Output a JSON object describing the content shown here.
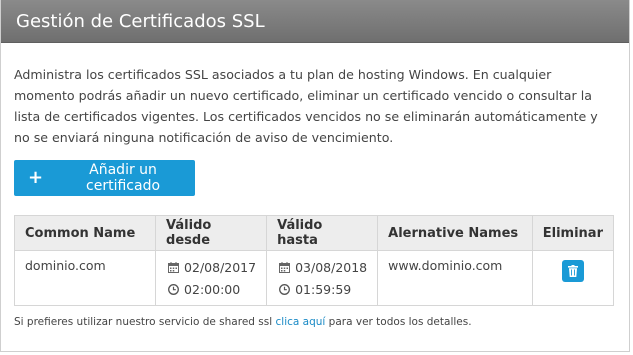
{
  "header": {
    "title": "Gestión de Certificados SSL"
  },
  "intro": "Administra los certificados SSL asociados a tu plan de hosting Windows. En cualquier momento podrás añadir un nuevo certificado, eliminar un certificado vencido o consultar la lista de certificados vigentes. Los certificados vencidos no se eliminarán automáticamente y no se enviará ninguna notificación de aviso de vencimiento.",
  "add_button": {
    "icon": "plus-icon",
    "label": "Añadir un certificado"
  },
  "table": {
    "headers": [
      "Common Name",
      "Válido desde",
      "Válido hasta",
      "Alernative Names",
      "Eliminar"
    ],
    "rows": [
      {
        "common_name": "dominio.com",
        "valid_from_date": "02/08/2017",
        "valid_from_time": "02:00:00",
        "valid_to_date": "03/08/2018",
        "valid_to_time": "01:59:59",
        "alt_names": "www.dominio.com",
        "delete_icon": "trash-icon"
      }
    ]
  },
  "footnote": {
    "before": "Si prefieres utilizar nuestro servicio de shared ssl ",
    "link": "clica aquí",
    "after": " para ver todos los detalles."
  },
  "colors": {
    "accent": "#1a9ad6",
    "header_bg": "#7d7d7d",
    "link": "#1a8ac6"
  }
}
